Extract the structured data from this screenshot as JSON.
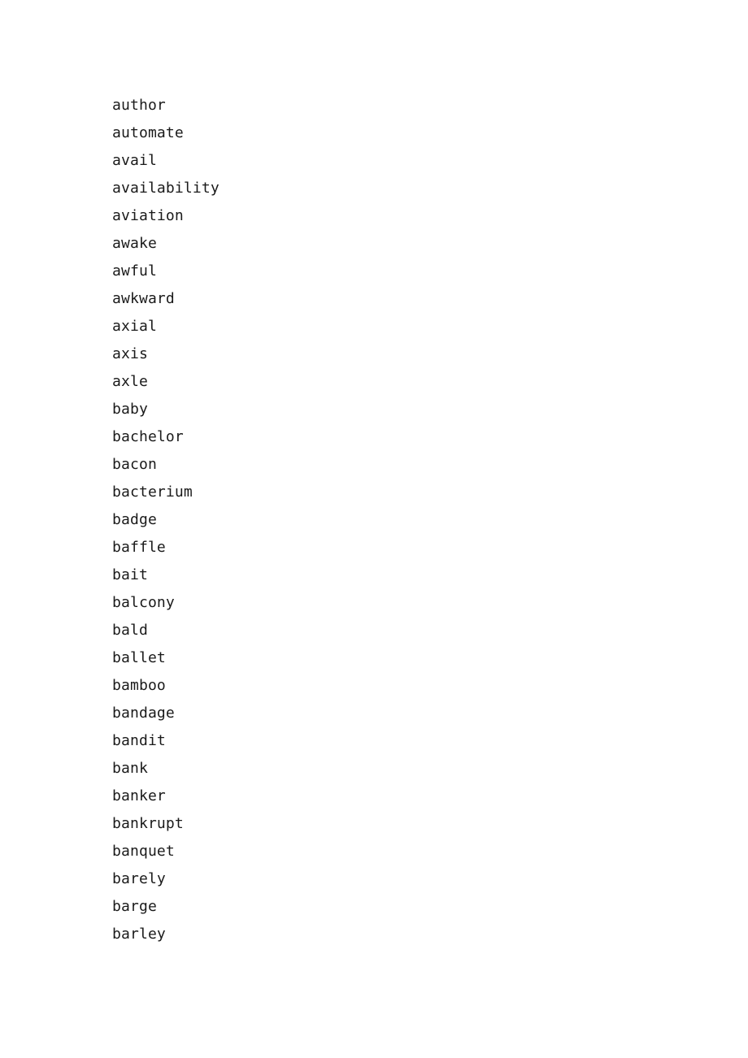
{
  "document": {
    "type": "word-list",
    "page_background": "#ffffff",
    "text_color": "#1a1a1a",
    "word_count": 31,
    "words": [
      "author",
      "automate",
      "avail",
      "availability",
      "aviation",
      "awake",
      "awful",
      "awkward",
      "axial",
      "axis",
      "axle",
      "baby",
      "bachelor",
      "bacon",
      "bacterium",
      "badge",
      "baffle",
      "bait",
      "balcony",
      "bald",
      "ballet",
      "bamboo",
      "bandage",
      "bandit",
      "bank",
      "banker",
      "bankrupt",
      "banquet",
      "barely",
      "barge",
      "barley"
    ]
  }
}
